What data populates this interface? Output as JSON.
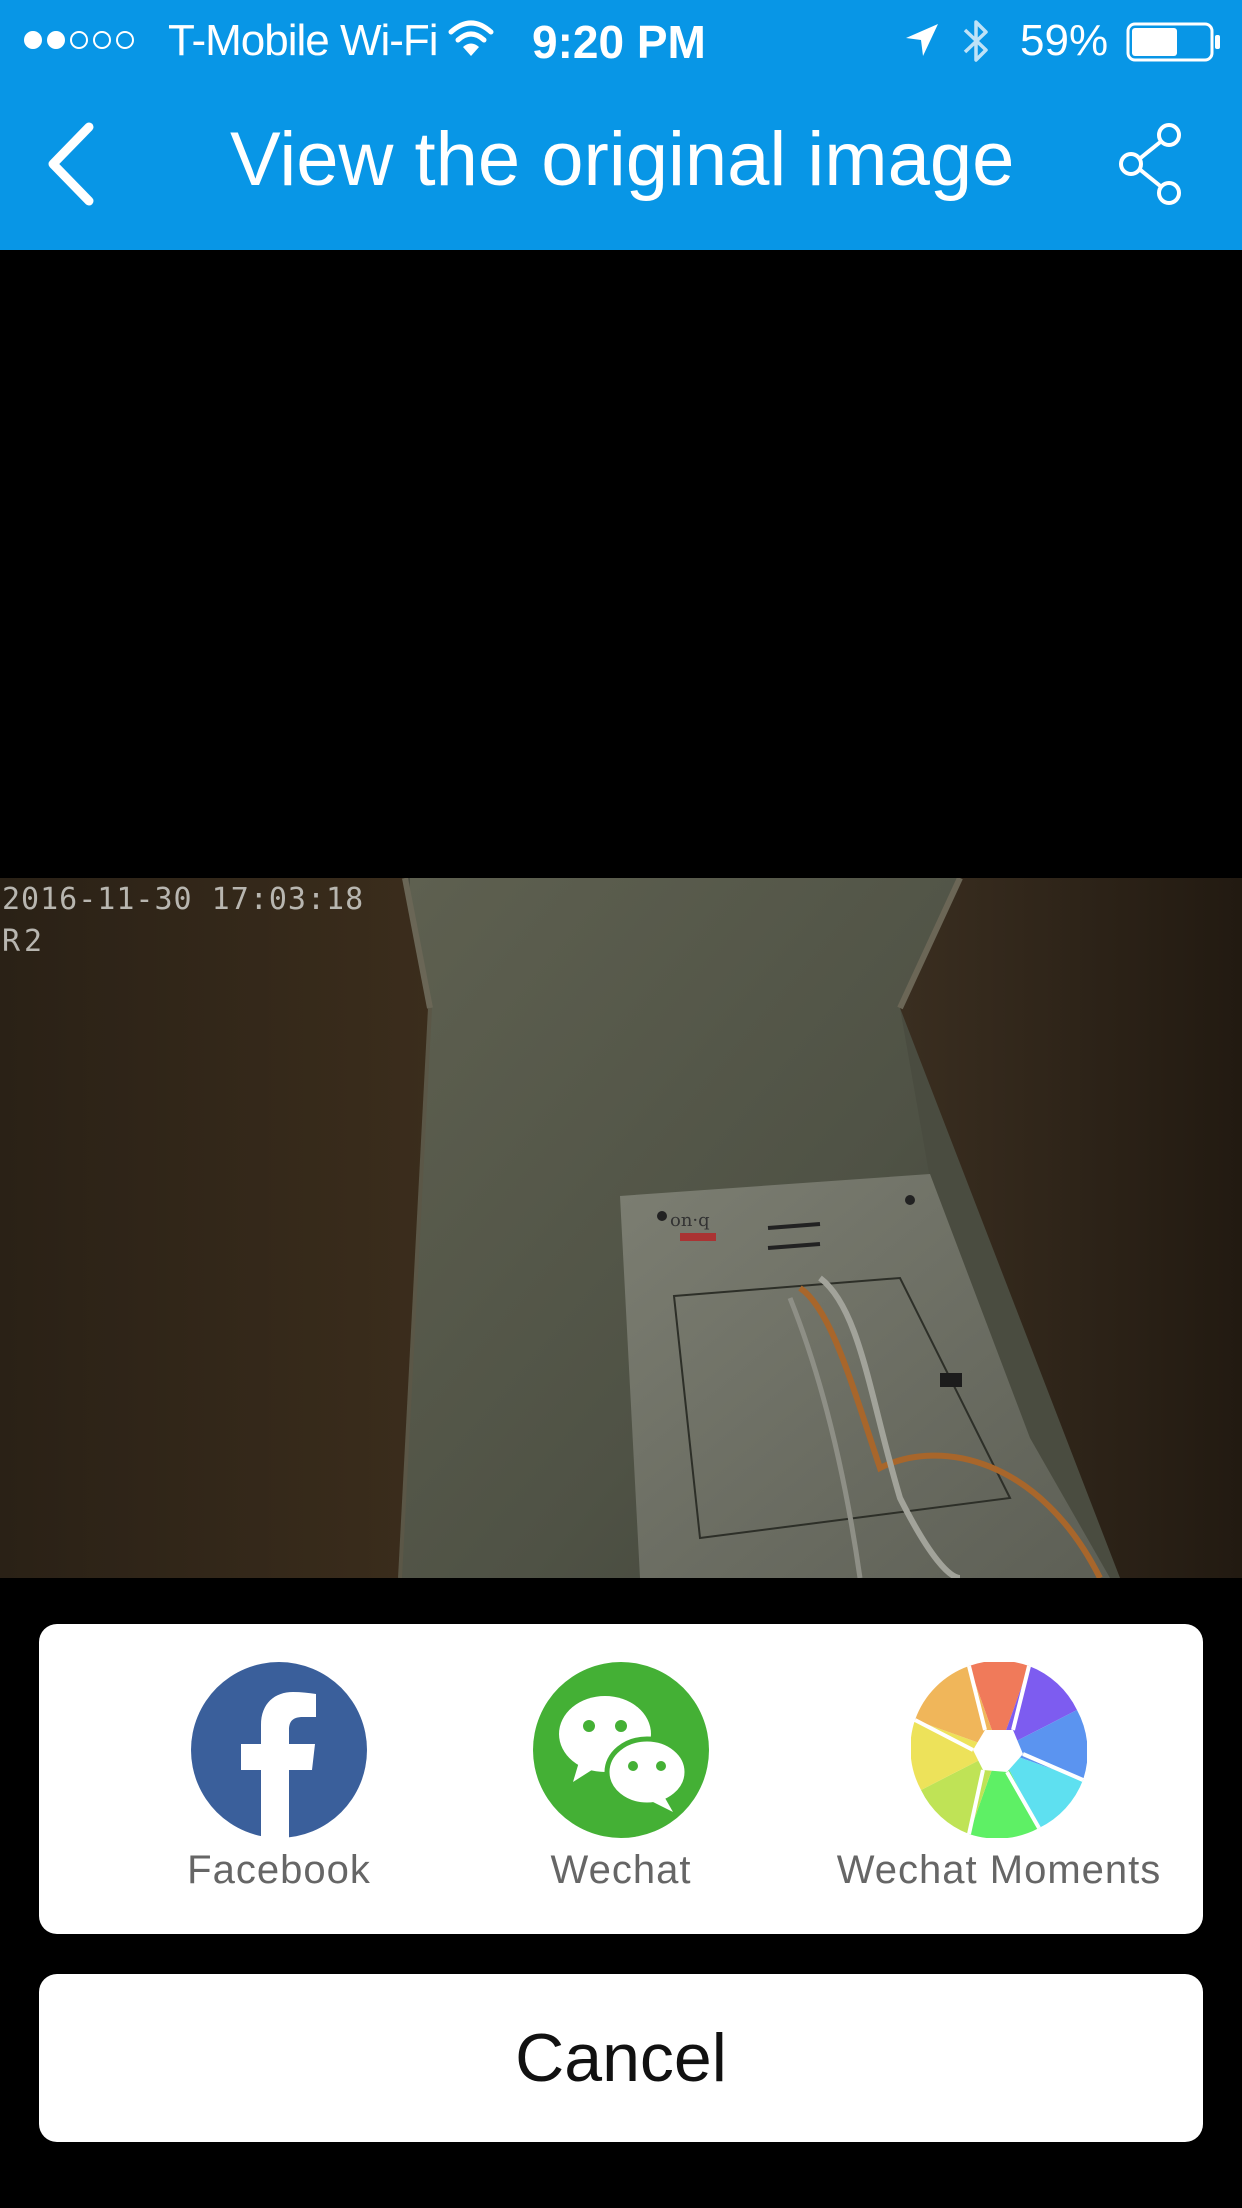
{
  "status_bar": {
    "carrier": "T-Mobile Wi-Fi",
    "time": "9:20 PM",
    "battery": "59%",
    "battery_level": 0.59,
    "signal_bars_filled": 2,
    "signal_bars_total": 5
  },
  "nav": {
    "title": "View the original image",
    "back_icon": "chevron-left-icon",
    "share_icon": "share-icon"
  },
  "image": {
    "timestamp": "2016-11-30 17:03:18",
    "channel": "R2"
  },
  "share_sheet": {
    "options": [
      {
        "label": "Facebook",
        "icon": "facebook-icon",
        "color": "#3a5f9b"
      },
      {
        "label": "Wechat",
        "icon": "wechat-icon",
        "color": "#44b035"
      },
      {
        "label": "Wechat Moments",
        "icon": "wechat-moments-icon",
        "color": "#ffffff"
      }
    ],
    "cancel_label": "Cancel"
  },
  "colors": {
    "header_bg": "#0896e6",
    "sheet_bg": "#ffffff",
    "backdrop": "#000000"
  }
}
